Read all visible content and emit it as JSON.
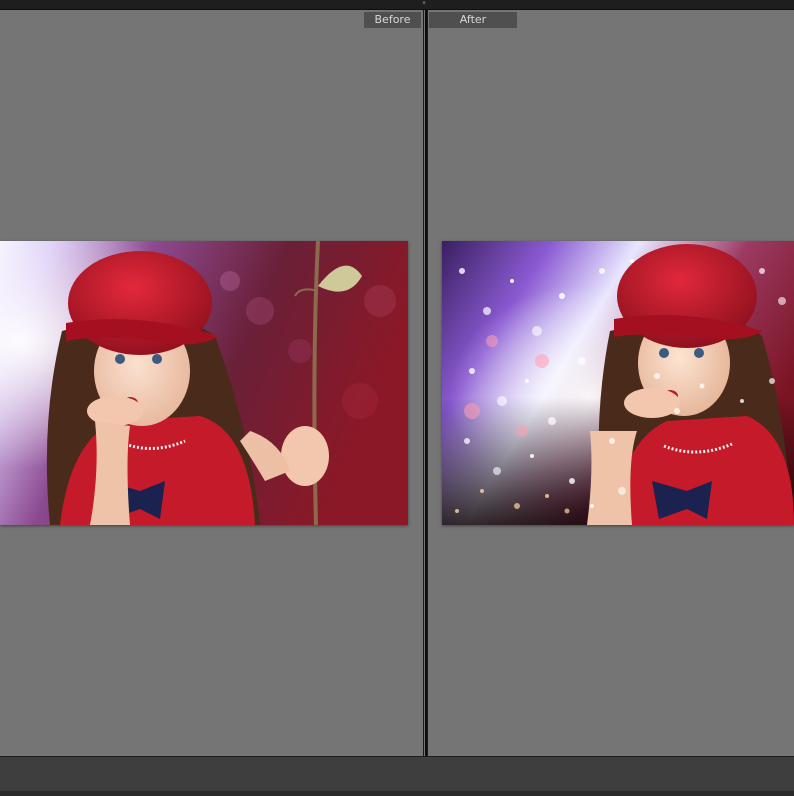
{
  "compare": {
    "before_label": "Before",
    "after_label": "After"
  },
  "icons": {
    "top_grip": "drag-handle-icon"
  },
  "colors": {
    "workspace": "#757575",
    "toolbar_dark": "#1e1e1e",
    "label_bg": "#4f4f4f",
    "label_text": "#d8d8d8"
  }
}
